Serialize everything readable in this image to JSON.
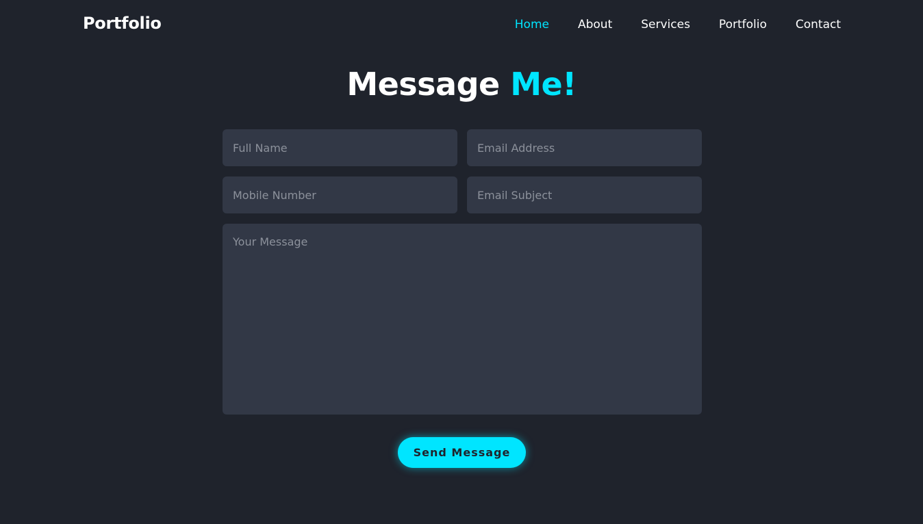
{
  "header": {
    "logo": "Portfolio",
    "nav": [
      {
        "label": "Home",
        "active": true
      },
      {
        "label": "About",
        "active": false
      },
      {
        "label": "Services",
        "active": false
      },
      {
        "label": "Portfolio",
        "active": false
      },
      {
        "label": "Contact",
        "active": false
      }
    ]
  },
  "section": {
    "title_main": "Message",
    "title_accent": "Me!"
  },
  "form": {
    "full_name": {
      "placeholder": "Full Name",
      "value": ""
    },
    "email": {
      "placeholder": "Email Address",
      "value": ""
    },
    "mobile": {
      "placeholder": "Mobile Number",
      "value": ""
    },
    "subject": {
      "placeholder": "Email Subject",
      "value": ""
    },
    "message": {
      "placeholder": "Your Message",
      "value": ""
    },
    "submit_label": "Send Message"
  },
  "colors": {
    "background": "#1f232c",
    "field_background": "#323846",
    "accent": "#00e5ff",
    "text": "#ffffff",
    "placeholder": "#8c919b"
  }
}
